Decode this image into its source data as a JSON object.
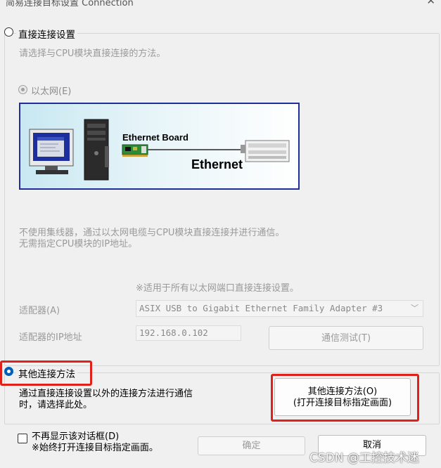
{
  "window": {
    "title": "简易连接目标设置 Connection",
    "close_icon": "close-icon"
  },
  "direct": {
    "radio_label": "直接连接设置",
    "description": "请选择与CPU模块直接连接的方法。",
    "ethernet_radio_label": "以太网(E)",
    "diagram": {
      "board_label": "Ethernet Board",
      "cable_label": "Ethernet"
    },
    "note_line1": "不使用集线器，通过以太网电缆与CPU模块直接连接并进行通信。",
    "note_line2": "无需指定CPU模块的IP地址。",
    "applies_note": "※适用于所有以太网端口直接连接设置。",
    "adapter_label": "适配器(A)",
    "adapter_value": "ASIX USB to Gigabit Ethernet Family Adapter #3",
    "ip_label": "适配器的IP地址",
    "ip_value": "192.168.0.102",
    "test_button": "通信测试(T)"
  },
  "other": {
    "radio_label": "其他连接方法",
    "description_line1": "通过直接连接设置以外的连接方法进行通信",
    "description_line2": "时，请选择此处。",
    "button_line1": "其他连接方法(O)",
    "button_line2": "(打开连接目标指定画面)"
  },
  "footer": {
    "checkbox_label": "不再显示该对话框(D)",
    "checkbox_note": "※始终打开连接目标指定画面。",
    "ok_button": "确定",
    "cancel_button": "取消"
  },
  "watermark": "CSDN @工控技术迷",
  "colors": {
    "highlight": "#e0201a",
    "radio_selected": "#005fb8",
    "diagram_border": "#1f2f9a"
  }
}
